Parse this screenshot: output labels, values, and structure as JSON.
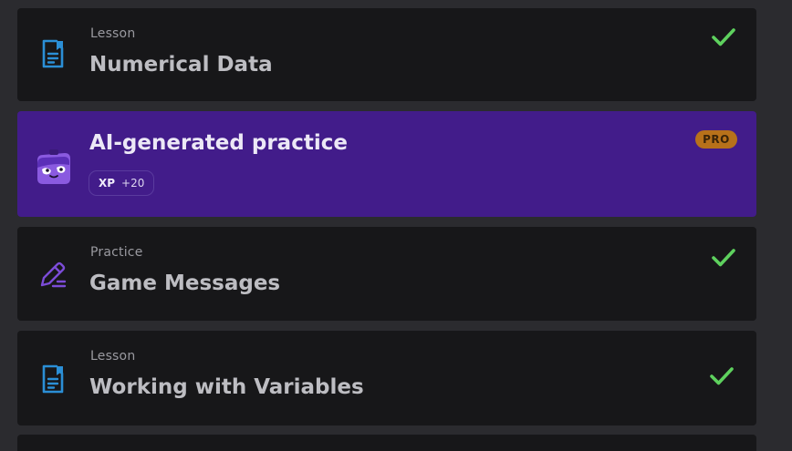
{
  "items": [
    {
      "kind": "Lesson",
      "title": "Numerical Data",
      "icon": "document-icon",
      "status": "completed"
    },
    {
      "title": "AI-generated practice",
      "badge": "PRO",
      "xp_label": "XP",
      "xp_value": "+20",
      "icon": "robot-mascot-icon",
      "accent": "#421c8a"
    },
    {
      "kind": "Practice",
      "title": "Game Messages",
      "icon": "pencil-icon",
      "status": "completed"
    },
    {
      "kind": "Lesson",
      "title": "Working with Variables",
      "icon": "document-icon",
      "status": "completed"
    }
  ],
  "colors": {
    "card": "#171719",
    "pro_card": "#421c8a",
    "check": "#5ed15e",
    "lesson_icon": "#2b8fd6",
    "practice_icon": "#7c4cd8",
    "pro_badge": "#b8711a"
  }
}
